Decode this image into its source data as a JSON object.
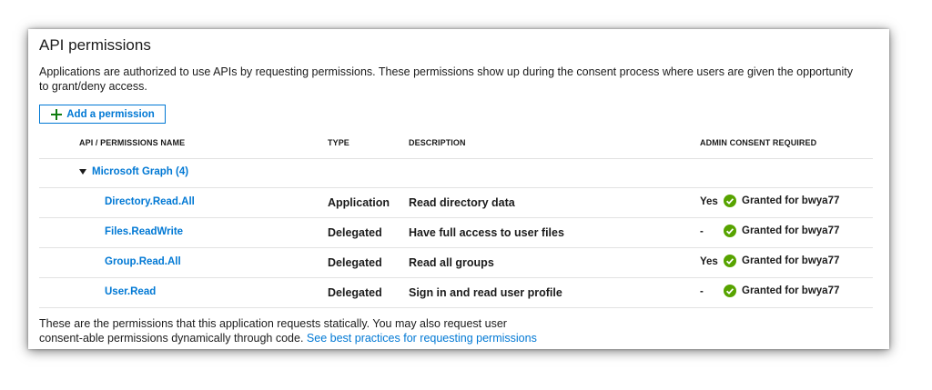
{
  "page": {
    "title": "API permissions",
    "description": "Applications are authorized to use APIs by requesting permissions. These permissions show up during the consent process where users are given the opportunity to grant/deny access."
  },
  "toolbar": {
    "add_permission_label": "Add a permission",
    "add_icon": "plus-icon"
  },
  "table": {
    "columns": {
      "name": "API / PERMISSIONS NAME",
      "type": "TYPE",
      "description": "DESCRIPTION",
      "admin_consent": "ADMIN CONSENT REQUIRED"
    },
    "group": {
      "label": "Microsoft Graph (4)",
      "icon": "caret-down-icon"
    },
    "rows": [
      {
        "name": "Directory.Read.All",
        "type": "Application",
        "description": "Read directory data",
        "admin_consent": "Yes",
        "status": "Granted for bwya77"
      },
      {
        "name": "Files.ReadWrite",
        "type": "Delegated",
        "description": "Have full access to user files",
        "admin_consent": "-",
        "status": "Granted for bwya77"
      },
      {
        "name": "Group.Read.All",
        "type": "Delegated",
        "description": "Read all groups",
        "admin_consent": "Yes",
        "status": "Granted for bwya77"
      },
      {
        "name": "User.Read",
        "type": "Delegated",
        "description": "Sign in and read user profile",
        "admin_consent": "-",
        "status": "Granted for bwya77"
      }
    ]
  },
  "footer": {
    "text": "These are the permissions that this application requests statically. You may also request user consent-able permissions dynamically through code.",
    "link_label": "See best practices for requesting permissions"
  },
  "colors": {
    "link": "#0078d4",
    "plus": "#107c10",
    "granted": "#57a300",
    "divider": "#e1e1e1",
    "text": "#1b1b1b"
  }
}
